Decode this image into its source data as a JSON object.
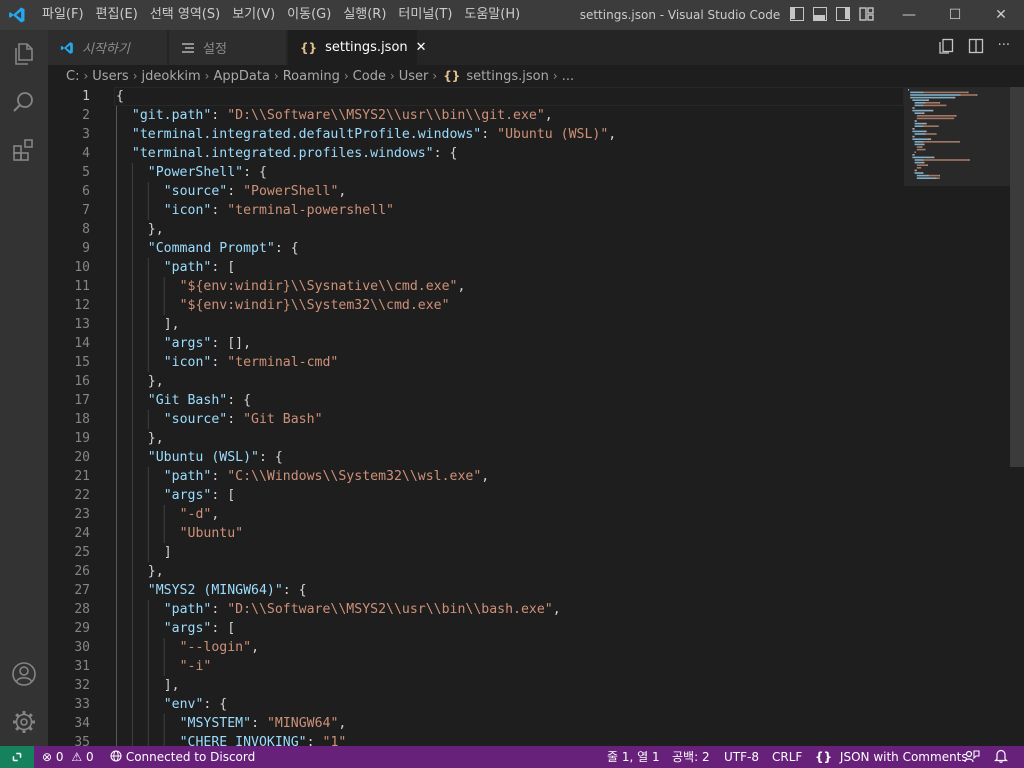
{
  "titlebar": {
    "menu": [
      "파일(F)",
      "편집(E)",
      "선택 영역(S)",
      "보기(V)",
      "이동(G)",
      "실행(R)",
      "터미널(T)",
      "도움말(H)"
    ],
    "window_title": "settings.json - Visual Studio Code",
    "controls": {
      "minimize": "—",
      "maximize": "☐",
      "close": "✕"
    }
  },
  "tabs": [
    {
      "label": "시작하기",
      "icon": "vscode-logo-icon",
      "active": false
    },
    {
      "label": "설정",
      "icon": "settings-list-icon",
      "active": false
    },
    {
      "label": "settings.json",
      "icon": "json-braces-icon",
      "active": true,
      "close": "✕"
    }
  ],
  "editor_actions": {
    "more": "···"
  },
  "breadcrumb": [
    "C:",
    "Users",
    "jdeokkim",
    "AppData",
    "Roaming",
    "Code",
    "User",
    "settings.json",
    "..."
  ],
  "breadcrumb_file_icon": "{}",
  "editor": {
    "current_line": 1,
    "lines": [
      {
        "n": 1,
        "indent": 0,
        "tokens": [
          [
            "p",
            "{"
          ]
        ]
      },
      {
        "n": 2,
        "indent": 1,
        "tokens": [
          [
            "k",
            "\"git.path\""
          ],
          [
            "p",
            ": "
          ],
          [
            "s",
            "\"D:\\\\Software\\\\MSYS2\\\\usr\\\\bin\\\\git.exe\""
          ],
          [
            "p",
            ","
          ]
        ]
      },
      {
        "n": 3,
        "indent": 1,
        "tokens": [
          [
            "k",
            "\"terminal.integrated.defaultProfile.windows\""
          ],
          [
            "p",
            ": "
          ],
          [
            "s",
            "\"Ubuntu (WSL)\""
          ],
          [
            "p",
            ","
          ]
        ]
      },
      {
        "n": 4,
        "indent": 1,
        "tokens": [
          [
            "k",
            "\"terminal.integrated.profiles.windows\""
          ],
          [
            "p",
            ": {"
          ]
        ]
      },
      {
        "n": 5,
        "indent": 2,
        "tokens": [
          [
            "k",
            "\"PowerShell\""
          ],
          [
            "p",
            ": {"
          ]
        ]
      },
      {
        "n": 6,
        "indent": 3,
        "tokens": [
          [
            "k",
            "\"source\""
          ],
          [
            "p",
            ": "
          ],
          [
            "s",
            "\"PowerShell\""
          ],
          [
            "p",
            ","
          ]
        ]
      },
      {
        "n": 7,
        "indent": 3,
        "tokens": [
          [
            "k",
            "\"icon\""
          ],
          [
            "p",
            ": "
          ],
          [
            "s",
            "\"terminal-powershell\""
          ]
        ]
      },
      {
        "n": 8,
        "indent": 2,
        "tokens": [
          [
            "p",
            "},"
          ]
        ]
      },
      {
        "n": 9,
        "indent": 2,
        "tokens": [
          [
            "k",
            "\"Command Prompt\""
          ],
          [
            "p",
            ": {"
          ]
        ]
      },
      {
        "n": 10,
        "indent": 3,
        "tokens": [
          [
            "k",
            "\"path\""
          ],
          [
            "p",
            ": ["
          ]
        ]
      },
      {
        "n": 11,
        "indent": 4,
        "tokens": [
          [
            "s",
            "\"${env:windir}\\\\Sysnative\\\\cmd.exe\""
          ],
          [
            "p",
            ","
          ]
        ]
      },
      {
        "n": 12,
        "indent": 4,
        "tokens": [
          [
            "s",
            "\"${env:windir}\\\\System32\\\\cmd.exe\""
          ]
        ]
      },
      {
        "n": 13,
        "indent": 3,
        "tokens": [
          [
            "p",
            "],"
          ]
        ]
      },
      {
        "n": 14,
        "indent": 3,
        "tokens": [
          [
            "k",
            "\"args\""
          ],
          [
            "p",
            ": [],"
          ]
        ]
      },
      {
        "n": 15,
        "indent": 3,
        "tokens": [
          [
            "k",
            "\"icon\""
          ],
          [
            "p",
            ": "
          ],
          [
            "s",
            "\"terminal-cmd\""
          ]
        ]
      },
      {
        "n": 16,
        "indent": 2,
        "tokens": [
          [
            "p",
            "},"
          ]
        ]
      },
      {
        "n": 17,
        "indent": 2,
        "tokens": [
          [
            "k",
            "\"Git Bash\""
          ],
          [
            "p",
            ": {"
          ]
        ]
      },
      {
        "n": 18,
        "indent": 3,
        "tokens": [
          [
            "k",
            "\"source\""
          ],
          [
            "p",
            ": "
          ],
          [
            "s",
            "\"Git Bash\""
          ]
        ]
      },
      {
        "n": 19,
        "indent": 2,
        "tokens": [
          [
            "p",
            "},"
          ]
        ]
      },
      {
        "n": 20,
        "indent": 2,
        "tokens": [
          [
            "k",
            "\"Ubuntu (WSL)\""
          ],
          [
            "p",
            ": {"
          ]
        ]
      },
      {
        "n": 21,
        "indent": 3,
        "tokens": [
          [
            "k",
            "\"path\""
          ],
          [
            "p",
            ": "
          ],
          [
            "s",
            "\"C:\\\\Windows\\\\System32\\\\wsl.exe\""
          ],
          [
            "p",
            ","
          ]
        ]
      },
      {
        "n": 22,
        "indent": 3,
        "tokens": [
          [
            "k",
            "\"args\""
          ],
          [
            "p",
            ": ["
          ]
        ]
      },
      {
        "n": 23,
        "indent": 4,
        "tokens": [
          [
            "s",
            "\"-d\""
          ],
          [
            "p",
            ","
          ]
        ]
      },
      {
        "n": 24,
        "indent": 4,
        "tokens": [
          [
            "s",
            "\"Ubuntu\""
          ]
        ]
      },
      {
        "n": 25,
        "indent": 3,
        "tokens": [
          [
            "p",
            "]"
          ]
        ]
      },
      {
        "n": 26,
        "indent": 2,
        "tokens": [
          [
            "p",
            "},"
          ]
        ]
      },
      {
        "n": 27,
        "indent": 2,
        "tokens": [
          [
            "k",
            "\"MSYS2 (MINGW64)\""
          ],
          [
            "p",
            ": {"
          ]
        ]
      },
      {
        "n": 28,
        "indent": 3,
        "tokens": [
          [
            "k",
            "\"path\""
          ],
          [
            "p",
            ": "
          ],
          [
            "s",
            "\"D:\\\\Software\\\\MSYS2\\\\usr\\\\bin\\\\bash.exe\""
          ],
          [
            "p",
            ","
          ]
        ]
      },
      {
        "n": 29,
        "indent": 3,
        "tokens": [
          [
            "k",
            "\"args\""
          ],
          [
            "p",
            ": ["
          ]
        ]
      },
      {
        "n": 30,
        "indent": 4,
        "tokens": [
          [
            "s",
            "\"--login\""
          ],
          [
            "p",
            ","
          ]
        ]
      },
      {
        "n": 31,
        "indent": 4,
        "tokens": [
          [
            "s",
            "\"-i\""
          ]
        ]
      },
      {
        "n": 32,
        "indent": 3,
        "tokens": [
          [
            "p",
            "],"
          ]
        ]
      },
      {
        "n": 33,
        "indent": 3,
        "tokens": [
          [
            "k",
            "\"env\""
          ],
          [
            "p",
            ": {"
          ]
        ]
      },
      {
        "n": 34,
        "indent": 4,
        "tokens": [
          [
            "k",
            "\"MSYSTEM\""
          ],
          [
            "p",
            ": "
          ],
          [
            "s",
            "\"MINGW64\""
          ],
          [
            "p",
            ","
          ]
        ]
      },
      {
        "n": 35,
        "indent": 4,
        "tokens": [
          [
            "k",
            "\"CHERE_INVOKING\""
          ],
          [
            "p",
            ": "
          ],
          [
            "s",
            "\"1\""
          ]
        ]
      }
    ]
  },
  "statusbar": {
    "errors": "0",
    "warnings": "0",
    "discord": "Connected to Discord",
    "cursor": "줄 1, 열 1",
    "spaces": "공백: 2",
    "encoding": "UTF-8",
    "eol": "CRLF",
    "language": "JSON with Comments",
    "language_icon": "{}"
  },
  "colors": {
    "statusbar_bg": "#68217a",
    "remote_bg": "#16825d",
    "json_key": "#9cdcfe",
    "json_string": "#ce9178",
    "punctuation": "#d4d4d4",
    "vscode_blue": "#23a9f2",
    "json_icon": "#e2c08d"
  }
}
